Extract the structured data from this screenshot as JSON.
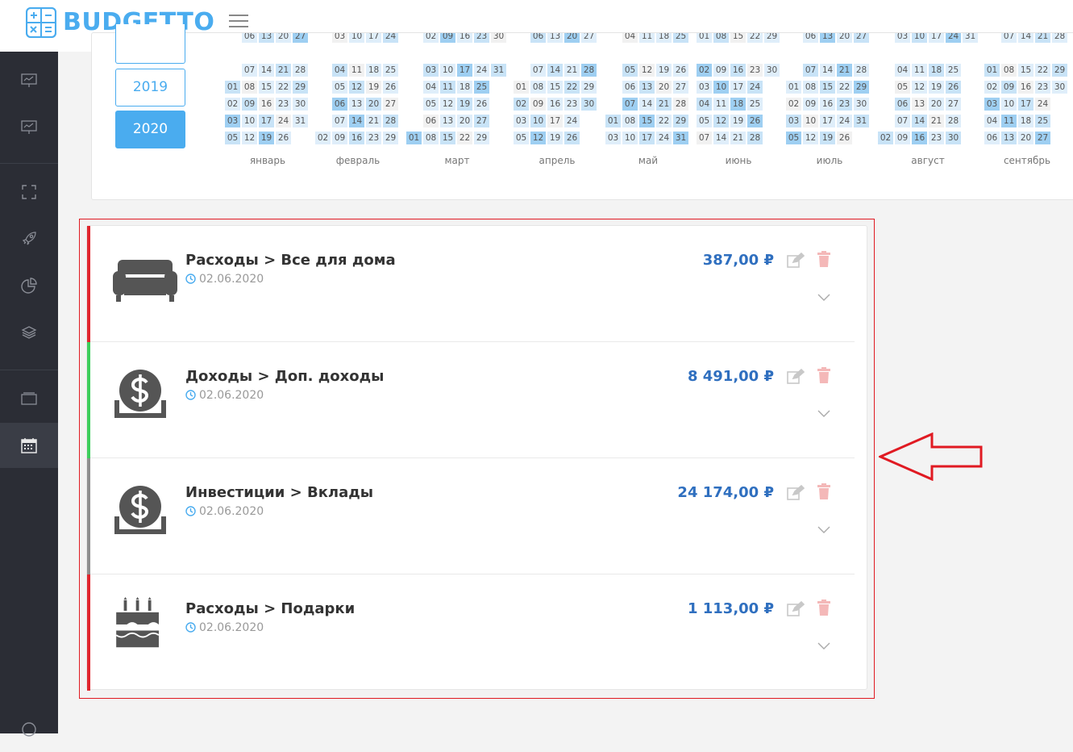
{
  "app": {
    "name": "BUDGETTO",
    "accent": "#4aacef"
  },
  "sidebar": {
    "items": [
      {
        "icon": "presentation-icon"
      },
      {
        "icon": "presentation-icon"
      },
      {
        "icon": "fullscreen-icon"
      },
      {
        "icon": "rocket-icon"
      },
      {
        "icon": "pie-chart-icon"
      },
      {
        "icon": "layers-icon"
      },
      {
        "icon": "window-icon"
      },
      {
        "icon": "calendar-icon",
        "active": true
      },
      {
        "icon": "help-icon"
      }
    ]
  },
  "years": {
    "items": [
      "2019",
      "2020"
    ],
    "selected": "2020"
  },
  "calendar": {
    "months": [
      {
        "label": "январь",
        "weeks": [
          [
            "",
            "",
            "",
            "",
            "",
            "",
            ""
          ],
          [
            "01",
            "02",
            "03",
            "04",
            "05"
          ],
          [
            "08",
            "09",
            "10",
            "11",
            "12"
          ],
          [
            "15",
            "16",
            "17",
            "18",
            "19"
          ],
          [
            "22",
            "23",
            "24",
            "25",
            "26"
          ],
          [
            "29",
            "30",
            "31",
            "",
            ""
          ]
        ]
      },
      {
        "label": "февраль"
      },
      {
        "label": "март"
      },
      {
        "label": "апрель"
      },
      {
        "label": "май"
      },
      {
        "label": "июнь"
      },
      {
        "label": "июль"
      },
      {
        "label": "август"
      },
      {
        "label": "сентябрь"
      }
    ]
  },
  "transactions": [
    {
      "title": "Расходы > Все для дома",
      "date": "02.06.2020",
      "amount": "387,00 ₽",
      "color": "#e0262e",
      "icon": "sofa-icon"
    },
    {
      "title": "Доходы > Доп. доходы",
      "date": "02.06.2020",
      "amount": "8 491,00 ₽",
      "color": "#3cce5c",
      "icon": "money-icon"
    },
    {
      "title": "Инвестиции > Вклады",
      "date": "02.06.2020",
      "amount": "24 174,00 ₽",
      "color": "#8e8e8e",
      "icon": "money-icon"
    },
    {
      "title": "Расходы > Подарки",
      "date": "02.06.2020",
      "amount": "1 113,00 ₽",
      "color": "#e0262e",
      "icon": "cake-icon"
    }
  ],
  "annotation": {
    "arrow_color": "#e01a22"
  }
}
